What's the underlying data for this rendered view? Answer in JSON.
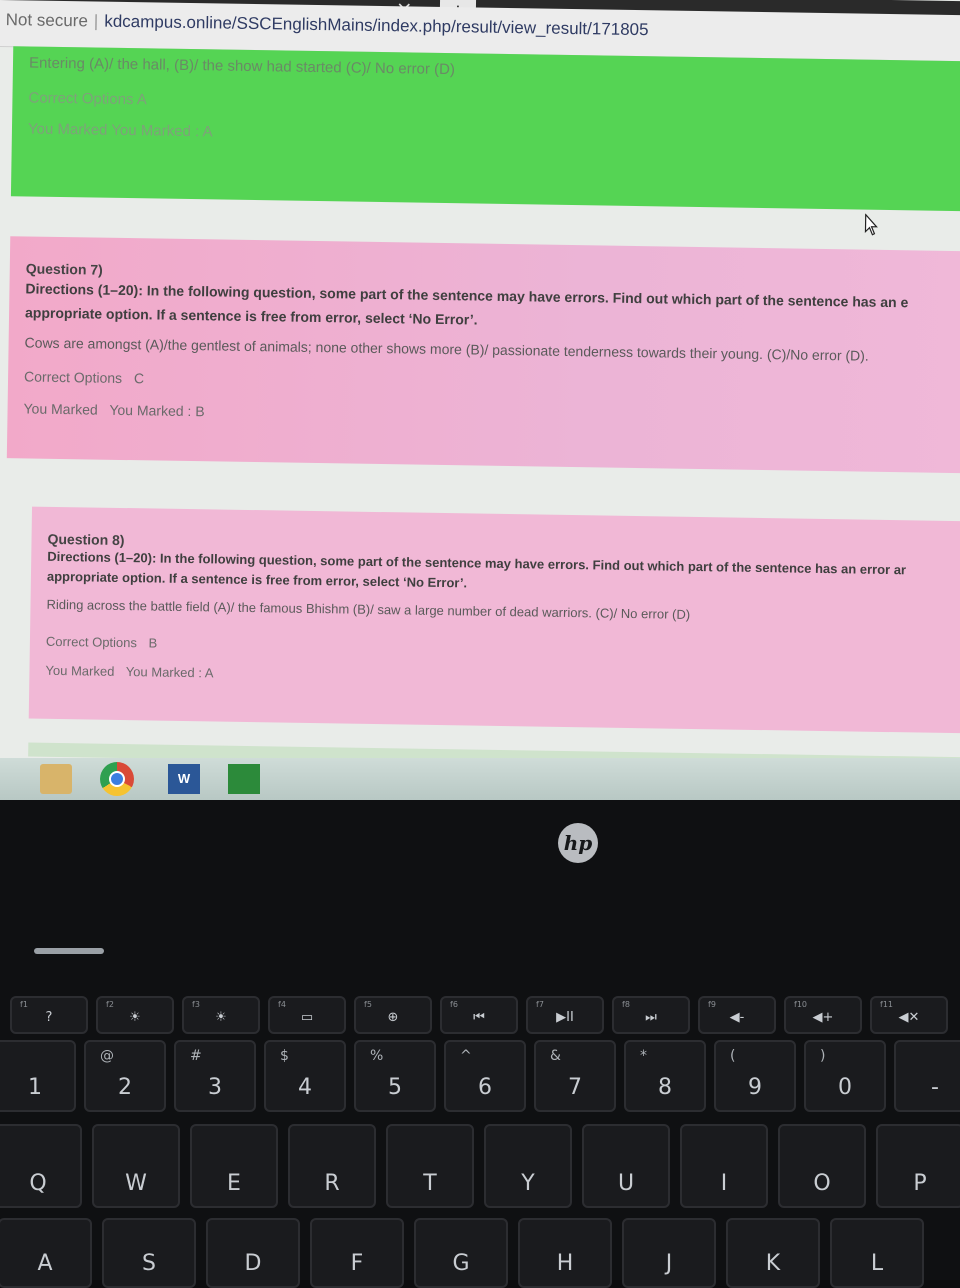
{
  "browser": {
    "tab_close": "×",
    "tab_new": "+",
    "security_label": "Not secure",
    "separator": "|",
    "url": "kdcampus.online/SSCEnglishMains/index.php/result/view_result/171805"
  },
  "prev_question": {
    "sentence": "Entering (A)/ the hall, (B)/ the show had started (C)/ No error (D)",
    "correct_label": "Correct Options",
    "correct_value": "A",
    "marked_label": "You Marked",
    "marked_value": "You Marked : A"
  },
  "questions": [
    {
      "title": "Question 7)",
      "directions": "Directions (1–20): In the following question, some part of the sentence may have errors. Find out which part of the sentence has an e",
      "directions_2": "appropriate option. If a sentence is free from error, select ‘No Error’.",
      "sentence": "Cows are amongst (A)/the gentlest of animals; none other shows more (B)/ passionate tenderness towards their young. (C)/No error (D).",
      "correct_label": "Correct Options",
      "correct_value": "C",
      "marked_label": "You Marked",
      "marked_value": "You Marked : B"
    },
    {
      "title": "Question 8)",
      "directions": "Directions (1–20): In the following question, some part of the sentence may have errors. Find out which part of the sentence has an error ar",
      "directions_2": "appropriate option. If a sentence is free from error, select ‘No Error’.",
      "sentence": "Riding across the battle field (A)/ the famous Bhishm (B)/ saw a large number of dead warriors. (C)/ No error (D)",
      "correct_label": "Correct Options",
      "correct_value": "B",
      "marked_label": "You Marked",
      "marked_value": "You Marked : A"
    }
  ],
  "colors": {
    "correct_block": "#55d454",
    "wrong_block": "#f1b8d6"
  },
  "taskbar": {
    "icons": [
      "folder-icon",
      "chrome-icon",
      "word-icon",
      "store-icon"
    ],
    "word_letter": "W"
  },
  "laptop": {
    "brand": "hp",
    "fn_row": [
      {
        "fn": "f1",
        "glyph": "?"
      },
      {
        "fn": "f2",
        "glyph": "☀"
      },
      {
        "fn": "f3",
        "glyph": "☀"
      },
      {
        "fn": "f4",
        "glyph": "▭"
      },
      {
        "fn": "f5",
        "glyph": "⊕"
      },
      {
        "fn": "f6",
        "glyph": "⏮"
      },
      {
        "fn": "f7",
        "glyph": "▶II"
      },
      {
        "fn": "f8",
        "glyph": "⏭"
      },
      {
        "fn": "f9",
        "glyph": "◀-"
      },
      {
        "fn": "f10",
        "glyph": "◀+"
      },
      {
        "fn": "f11",
        "glyph": "◀✕"
      }
    ],
    "number_row": [
      {
        "main": "1",
        "shift": ""
      },
      {
        "main": "2",
        "shift": "@"
      },
      {
        "main": "3",
        "shift": "#"
      },
      {
        "main": "4",
        "shift": "$"
      },
      {
        "main": "5",
        "shift": "%"
      },
      {
        "main": "6",
        "shift": "^"
      },
      {
        "main": "7",
        "shift": "&"
      },
      {
        "main": "8",
        "shift": "*"
      },
      {
        "main": "9",
        "shift": "("
      },
      {
        "main": "0",
        "shift": ")"
      },
      {
        "main": "-",
        "shift": ""
      }
    ],
    "qwerty_row": [
      "Q",
      "W",
      "E",
      "R",
      "T",
      "Y",
      "U",
      "I",
      "O",
      "P"
    ],
    "home_row": [
      "A",
      "S",
      "D",
      "F",
      "G",
      "H",
      "J",
      "K",
      "L"
    ]
  }
}
